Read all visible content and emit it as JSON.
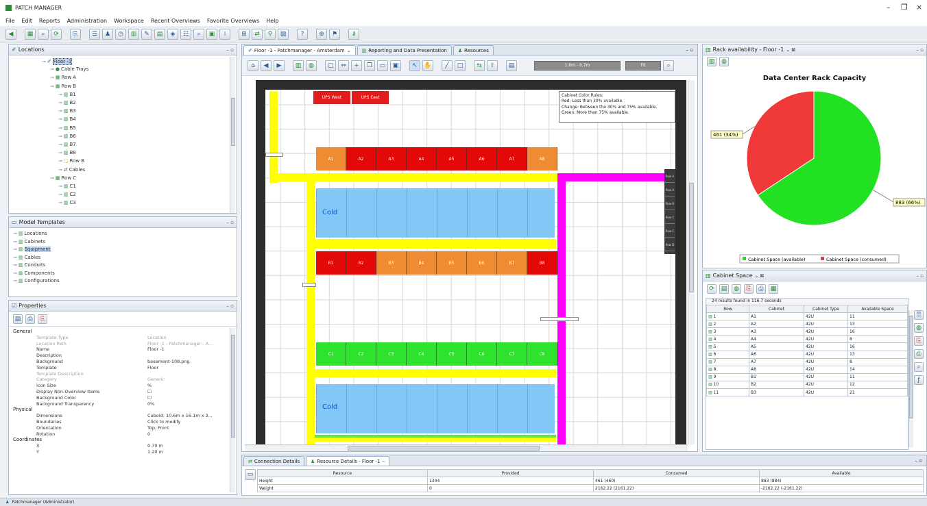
{
  "app": {
    "title": "PATCH MANAGER"
  },
  "window_controls": {
    "minimize": "–",
    "maximize": "❐",
    "close": "×"
  },
  "menu": [
    "File",
    "Edit",
    "Reports",
    "Administration",
    "Workspace",
    "Recent Overviews",
    "Favorite Overviews",
    "Help"
  ],
  "locations_panel": {
    "title": "Locations",
    "tree": [
      {
        "label": "Floor -1",
        "level": 0,
        "icon": "floor",
        "selected": true
      },
      {
        "label": "Cable Trays",
        "level": 1,
        "icon": "tray"
      },
      {
        "label": "Row A",
        "level": 1,
        "icon": "row"
      },
      {
        "label": "Row B",
        "level": 1,
        "icon": "row"
      },
      {
        "label": "B1",
        "level": 2,
        "icon": "cab"
      },
      {
        "label": "B2",
        "level": 2,
        "icon": "cab"
      },
      {
        "label": "B3",
        "level": 2,
        "icon": "cab"
      },
      {
        "label": "B4",
        "level": 2,
        "icon": "cab"
      },
      {
        "label": "B5",
        "level": 2,
        "icon": "cab"
      },
      {
        "label": "B6",
        "level": 2,
        "icon": "cab"
      },
      {
        "label": "B7",
        "level": 2,
        "icon": "cab"
      },
      {
        "label": "B8",
        "level": 2,
        "icon": "cab"
      },
      {
        "label": "Row B",
        "level": 2,
        "icon": "rowy"
      },
      {
        "label": "Cables",
        "level": 2,
        "icon": "cables"
      },
      {
        "label": "Row C",
        "level": 1,
        "icon": "row"
      },
      {
        "label": "C1",
        "level": 2,
        "icon": "cab"
      },
      {
        "label": "C2",
        "level": 2,
        "icon": "cab"
      },
      {
        "label": "C3",
        "level": 2,
        "icon": "cab"
      }
    ]
  },
  "model_templates": {
    "title": "Model Templates",
    "items": [
      "Locations",
      "Cabinets",
      "Equipment",
      "Cables",
      "Conduits",
      "Components",
      "Configurations"
    ]
  },
  "properties": {
    "title": "Properties",
    "groups": [
      {
        "name": "General",
        "rows": [
          {
            "k": "Template Type",
            "v": "Location",
            "dim": true
          },
          {
            "k": "Location Path",
            "v": "Floor -1 - Patchmanager - A...",
            "dim": true
          },
          {
            "k": "Name",
            "v": "Floor -1"
          },
          {
            "k": "Description",
            "v": ""
          },
          {
            "k": "Background",
            "v": "basement-108.png"
          },
          {
            "k": "Template",
            "v": "Floor"
          },
          {
            "k": "Template Description",
            "v": "",
            "dim": true
          },
          {
            "k": "Category",
            "v": "Generic",
            "dim": true
          },
          {
            "k": "Icon Size",
            "v": "%"
          },
          {
            "k": "Display Non-Overview Items",
            "v": "☐"
          },
          {
            "k": "Background Color",
            "v": "☐"
          },
          {
            "k": "Background Transparency",
            "v": "0%"
          }
        ]
      },
      {
        "name": "Physical",
        "rows": [
          {
            "k": "Dimensions",
            "v": "Cuboid: 10.6m x 16.1m x 3..."
          },
          {
            "k": "Boundaries",
            "v": "Click to modify"
          },
          {
            "k": "Orientation",
            "v": "Top, Front"
          },
          {
            "k": "Rotation",
            "v": "0"
          }
        ]
      },
      {
        "name": "Coordinates",
        "rows": [
          {
            "k": "X",
            "v": "0.70 m"
          },
          {
            "k": "Y",
            "v": "1.20 m"
          }
        ]
      }
    ]
  },
  "center": {
    "tabs": [
      "Floor -1 - Patchmanager - Amsterdam",
      "Reporting and Data Presentation",
      "Resources"
    ],
    "zoom_text": "1.0m - 0.7m",
    "zoom_btn": "Fit",
    "legend": [
      "Cabinet Color Rules:",
      "Red: Less than 30% available.",
      "Change: Between the 30% and 75% available.",
      "Green: More  than 75% available."
    ],
    "ups": [
      "UPS West",
      "UPS East"
    ],
    "row_a": [
      "A1",
      "A2",
      "A3",
      "A4",
      "A5",
      "A6",
      "A7",
      "A8"
    ],
    "row_a_colors": [
      "orange",
      "red",
      "red",
      "red",
      "red",
      "red",
      "red",
      "orange"
    ],
    "row_b": [
      "B1",
      "B2",
      "B3",
      "B4",
      "B5",
      "B6",
      "B7",
      "B8"
    ],
    "row_b_colors": [
      "red",
      "red",
      "orange",
      "orange",
      "orange",
      "orange",
      "orange",
      "red"
    ],
    "row_c": [
      "C1",
      "C2",
      "C3",
      "C4",
      "C5",
      "C6",
      "C7",
      "C8"
    ],
    "cold_label": "Cold",
    "side_units": [
      "Row A",
      "Row A",
      "Row B",
      "Row C",
      "Row C",
      "Row D"
    ]
  },
  "bottom": {
    "tabs": [
      "Connection Details",
      "Resource Details - Floor -1"
    ],
    "headers": [
      "Resource",
      "Provided",
      "Consumed",
      "Available"
    ],
    "rows": [
      [
        "Height",
        "1344",
        "461 (460)",
        "883 (884)"
      ],
      [
        "Weight",
        "0",
        "2162.22 (2161.22)",
        "-2162.22 (-2161.22)"
      ]
    ]
  },
  "rack_availability": {
    "title": "Rack availability - Floor -1",
    "chart_data": {
      "type": "pie",
      "title": "Data Center Rack Capacity",
      "slices": [
        {
          "label": "Cabinet Space (available)",
          "value": 883,
          "percent": 66,
          "color": "#22e022"
        },
        {
          "label": "Cabinet Space (consumed)",
          "value": 461,
          "percent": 34,
          "color": "#f03a3a"
        }
      ],
      "data_labels": [
        "461 (34%)",
        "883 (66%)"
      ],
      "legend_position": "bottom"
    }
  },
  "cabinet_space": {
    "title": "Cabinet Space",
    "status": "24 results found in 116.7 seconds",
    "headers": [
      "Row",
      "Cabinet",
      "Cabinet Type",
      "Available Space"
    ],
    "rows": [
      [
        "1",
        "A1",
        "42U",
        "11"
      ],
      [
        "2",
        "A2",
        "42U",
        "13"
      ],
      [
        "3",
        "A3",
        "42U",
        "16"
      ],
      [
        "4",
        "A4",
        "42U",
        "8"
      ],
      [
        "5",
        "A5",
        "42U",
        "16"
      ],
      [
        "6",
        "A6",
        "42U",
        "13"
      ],
      [
        "7",
        "A7",
        "42U",
        "8"
      ],
      [
        "8",
        "A8",
        "42U",
        "14"
      ],
      [
        "9",
        "B1",
        "42U",
        "11"
      ],
      [
        "10",
        "B2",
        "42U",
        "12"
      ],
      [
        "11",
        "B3",
        "42U",
        "21"
      ]
    ]
  },
  "statusbar": {
    "text": "Patchmanager (Administrator)"
  }
}
